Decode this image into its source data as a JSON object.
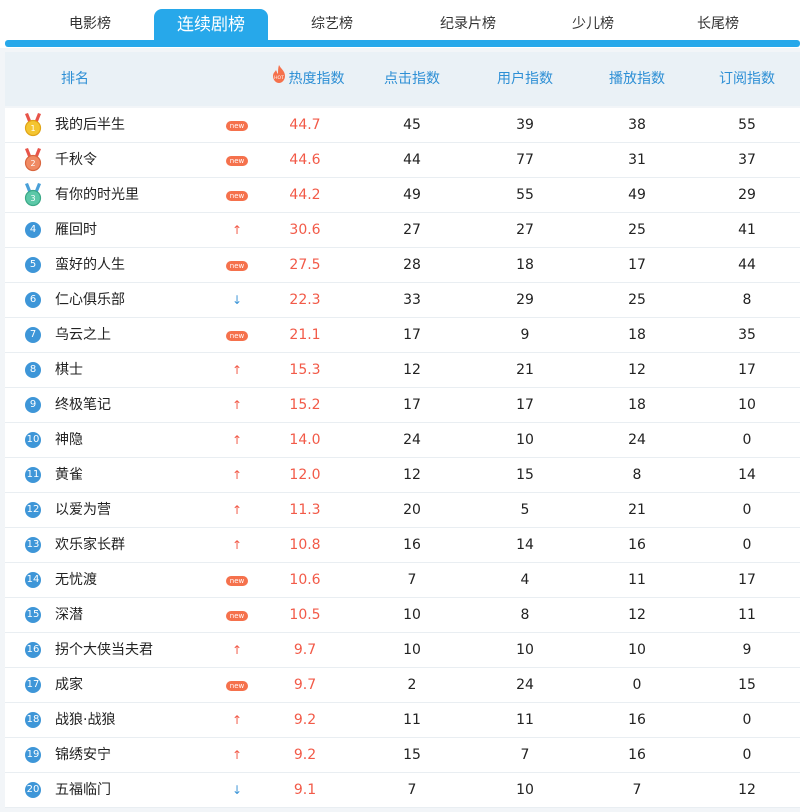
{
  "tabs": [
    {
      "label": "电影榜"
    },
    {
      "label": "连续剧榜"
    },
    {
      "label": "综艺榜"
    },
    {
      "label": "纪录片榜"
    },
    {
      "label": "少儿榜"
    },
    {
      "label": "长尾榜"
    }
  ],
  "active_tab": 1,
  "columns": {
    "rank": "排名",
    "heat": "热度指数",
    "click": "点击指数",
    "user": "用户指数",
    "play": "播放指数",
    "subscribe": "订阅指数"
  },
  "hot_badge": "HOT",
  "new_label": "new",
  "colors": {
    "accent": "#27a8ea",
    "heat": "#f25a48",
    "up": "#f25a48",
    "down": "#3e96d8",
    "new": "#f5714c"
  },
  "rows": [
    {
      "rank": "1",
      "name": "我的后半生",
      "trend": "new",
      "heat": "44.7",
      "click": "45",
      "user": "39",
      "play": "38",
      "subscribe": "55"
    },
    {
      "rank": "2",
      "name": "千秋令",
      "trend": "new",
      "heat": "44.6",
      "click": "44",
      "user": "77",
      "play": "31",
      "subscribe": "37"
    },
    {
      "rank": "3",
      "name": "有你的时光里",
      "trend": "new",
      "heat": "44.2",
      "click": "49",
      "user": "55",
      "play": "49",
      "subscribe": "29"
    },
    {
      "rank": "4",
      "name": "雁回时",
      "trend": "up",
      "heat": "30.6",
      "click": "27",
      "user": "27",
      "play": "25",
      "subscribe": "41"
    },
    {
      "rank": "5",
      "name": "蛮好的人生",
      "trend": "new",
      "heat": "27.5",
      "click": "28",
      "user": "18",
      "play": "17",
      "subscribe": "44"
    },
    {
      "rank": "6",
      "name": "仁心俱乐部",
      "trend": "down",
      "heat": "22.3",
      "click": "33",
      "user": "29",
      "play": "25",
      "subscribe": "8"
    },
    {
      "rank": "7",
      "name": "乌云之上",
      "trend": "new",
      "heat": "21.1",
      "click": "17",
      "user": "9",
      "play": "18",
      "subscribe": "35"
    },
    {
      "rank": "8",
      "name": "棋士",
      "trend": "up",
      "heat": "15.3",
      "click": "12",
      "user": "21",
      "play": "12",
      "subscribe": "17"
    },
    {
      "rank": "9",
      "name": "终极笔记",
      "trend": "up",
      "heat": "15.2",
      "click": "17",
      "user": "17",
      "play": "18",
      "subscribe": "10"
    },
    {
      "rank": "10",
      "name": "神隐",
      "trend": "up",
      "heat": "14.0",
      "click": "24",
      "user": "10",
      "play": "24",
      "subscribe": "0"
    },
    {
      "rank": "11",
      "name": "黄雀",
      "trend": "up",
      "heat": "12.0",
      "click": "12",
      "user": "15",
      "play": "8",
      "subscribe": "14"
    },
    {
      "rank": "12",
      "name": "以爱为营",
      "trend": "up",
      "heat": "11.3",
      "click": "20",
      "user": "5",
      "play": "21",
      "subscribe": "0"
    },
    {
      "rank": "13",
      "name": "欢乐家长群",
      "trend": "up",
      "heat": "10.8",
      "click": "16",
      "user": "14",
      "play": "16",
      "subscribe": "0"
    },
    {
      "rank": "14",
      "name": "无忧渡",
      "trend": "new",
      "heat": "10.6",
      "click": "7",
      "user": "4",
      "play": "11",
      "subscribe": "17"
    },
    {
      "rank": "15",
      "name": "深潜",
      "trend": "new",
      "heat": "10.5",
      "click": "10",
      "user": "8",
      "play": "12",
      "subscribe": "11"
    },
    {
      "rank": "16",
      "name": "拐个大侠当夫君",
      "trend": "up",
      "heat": "9.7",
      "click": "10",
      "user": "10",
      "play": "10",
      "subscribe": "9"
    },
    {
      "rank": "17",
      "name": "成家",
      "trend": "new",
      "heat": "9.7",
      "click": "2",
      "user": "24",
      "play": "0",
      "subscribe": "15"
    },
    {
      "rank": "18",
      "name": "战狼·战狼",
      "trend": "up",
      "heat": "9.2",
      "click": "11",
      "user": "11",
      "play": "16",
      "subscribe": "0"
    },
    {
      "rank": "19",
      "name": "锦绣安宁",
      "trend": "up",
      "heat": "9.2",
      "click": "15",
      "user": "7",
      "play": "16",
      "subscribe": "0"
    },
    {
      "rank": "20",
      "name": "五福临门",
      "trend": "down",
      "heat": "9.1",
      "click": "7",
      "user": "10",
      "play": "7",
      "subscribe": "12"
    }
  ]
}
